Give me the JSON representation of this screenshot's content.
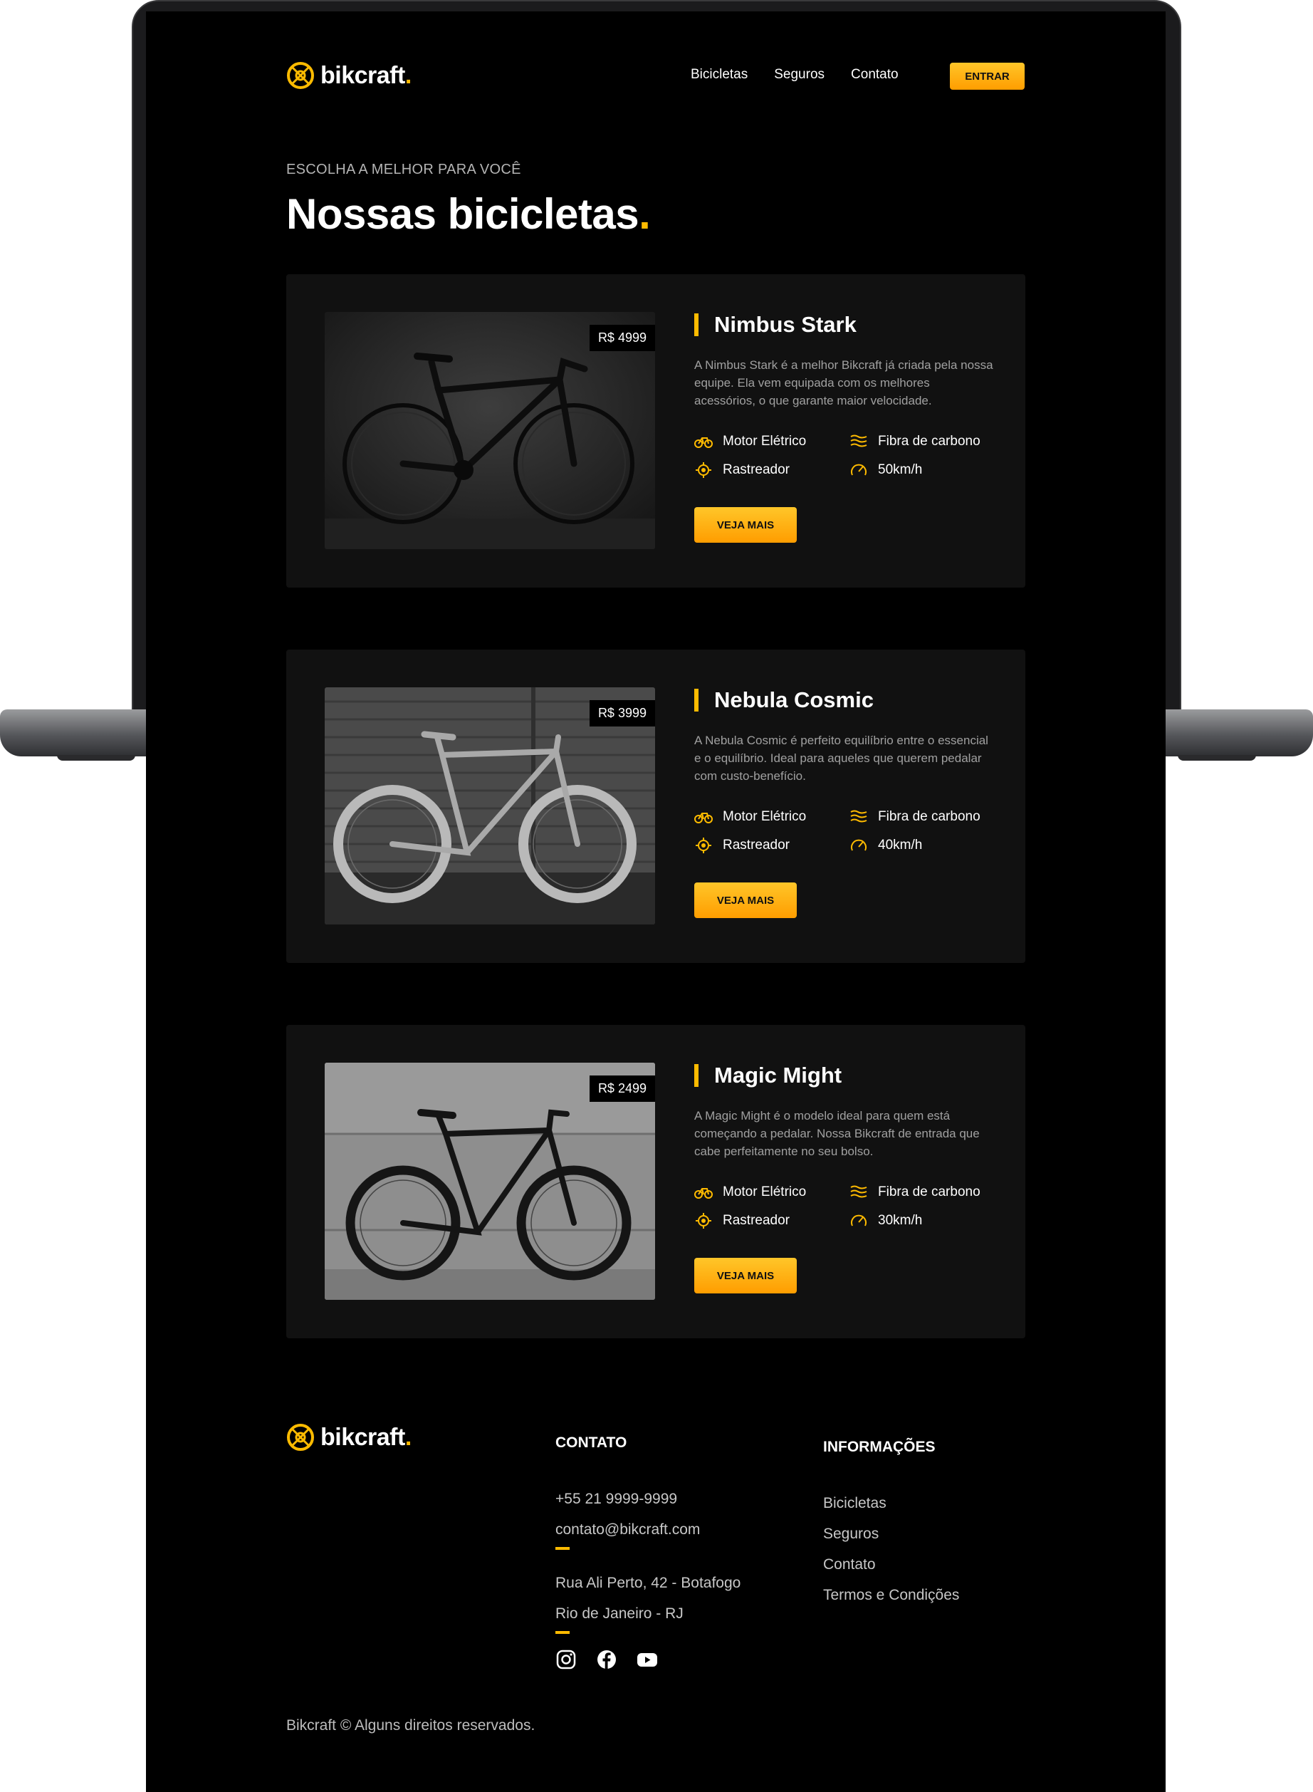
{
  "brand": {
    "name": "bikcraft",
    "dot": "."
  },
  "nav": {
    "items": [
      "Bicicletas",
      "Seguros",
      "Contato"
    ],
    "cta_label": "ENTRAR"
  },
  "hero": {
    "eyebrow": "ESCOLHA A MELHOR PARA VOCÊ",
    "title": "Nossas bicicletas",
    "title_dot": "."
  },
  "bikes": [
    {
      "name": "Nimbus Stark",
      "price": "R$ 4999",
      "description": "A Nimbus Stark é a melhor Bikcraft já criada pela nossa equipe. Ela vem equipada com os melhores acessórios, o que garante maior velocidade.",
      "features": [
        "Motor Elétrico",
        "Fibra de carbono",
        "Rastreador",
        "50km/h"
      ],
      "cta": "VEJA MAIS"
    },
    {
      "name": "Nebula Cosmic",
      "price": "R$ 3999",
      "description": "A Nebula Cosmic é perfeito equilíbrio entre o essencial e o equilíbrio. Ideal para aqueles que querem pedalar com custo-benefício.",
      "features": [
        "Motor Elétrico",
        "Fibra de carbono",
        "Rastreador",
        "40km/h"
      ],
      "cta": "VEJA MAIS"
    },
    {
      "name": "Magic Might",
      "price": "R$ 2499",
      "description": "A Magic Might é o modelo ideal para quem está começando a pedalar. Nossa Bikcraft de entrada que cabe perfeitamente no seu bolso.",
      "features": [
        "Motor Elétrico",
        "Fibra de carbono",
        "Rastreador",
        "30km/h"
      ],
      "cta": "VEJA MAIS"
    }
  ],
  "feature_icons": [
    "electric-bike-icon",
    "carbon-fiber-icon",
    "tracker-icon",
    "speedometer-icon"
  ],
  "footer": {
    "contact_title": "CONTATO",
    "phone": "+55 21 9999-9999",
    "email": "contato@bikcraft.com",
    "address_line1": "Rua Ali Perto, 42 - Botafogo",
    "address_line2": "Rio de Janeiro - RJ",
    "info_title": "INFORMAÇÕES",
    "info_links": [
      "Bicicletas",
      "Seguros",
      "Contato",
      "Termos e Condições"
    ],
    "social_icons": [
      "instagram-icon",
      "facebook-icon",
      "youtube-icon"
    ],
    "copyright": "Bikcraft © Alguns direitos reservados."
  },
  "colors": {
    "accent": "#ffbb00",
    "background": "#000000",
    "card": "#111111",
    "muted_text": "#a0a0a0"
  }
}
